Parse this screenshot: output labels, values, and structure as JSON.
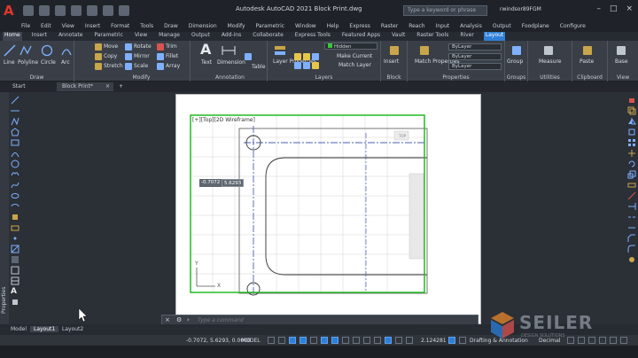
{
  "titlebar": {
    "title": "Autodesk AutoCAD 2021   Block Print.dwg",
    "search_placeholder": "Type a keyword or phrase",
    "user": "rwindsor89FGM"
  },
  "menubar": {
    "items": [
      "File",
      "Edit",
      "View",
      "Insert",
      "Format",
      "Tools",
      "Draw",
      "Dimension",
      "Modify",
      "Parametric",
      "Window",
      "Help",
      "Express",
      "Raster",
      "Reach",
      "Input",
      "Analysis",
      "Output",
      "Foodplane",
      "Configure"
    ]
  },
  "ribbon_tabs": [
    "Home",
    "Insert",
    "Annotate",
    "Parametric",
    "View",
    "Manage",
    "Output",
    "Add-ins",
    "Collaborate",
    "Express Tools",
    "Featured Apps",
    "Vault",
    "Raster Tools",
    "River",
    "Layout"
  ],
  "ribbon": {
    "draw": {
      "title": "Draw",
      "line": "Line",
      "polyline": "Polyline",
      "circle": "Circle",
      "arc": "Arc"
    },
    "modify": {
      "title": "Modify",
      "move": "Move",
      "rotate": "Rotate",
      "trim": "Trim",
      "copy": "Copy",
      "mirror": "Mirror",
      "fillet": "Fillet",
      "stretch": "Stretch",
      "scale": "Scale",
      "array": "Array"
    },
    "annotation": {
      "title": "Annotation",
      "text": "Text",
      "dimension": "Dimension",
      "table": "Table"
    },
    "layers": {
      "title": "Layers",
      "layer_properties": "Layer Properties",
      "layer_name": "Hidden",
      "make_current": "Make Current",
      "match_layer": "Match Layer"
    },
    "block": {
      "title": "Block",
      "insert": "Insert"
    },
    "properties": {
      "title": "Properties",
      "match": "Match Properties",
      "bylayer1": "ByLayer",
      "bylayer2": "ByLayer",
      "bylayer3": "ByLayer"
    },
    "groups": {
      "title": "Groups",
      "group": "Group"
    },
    "utilities": {
      "title": "Utilities",
      "measure": "Measure"
    },
    "clipboard": {
      "title": "Clipboard",
      "paste": "Paste"
    },
    "view": {
      "title": "View",
      "base": "Base"
    }
  },
  "file_tabs": {
    "start": "Start",
    "block_print": "Block Print*",
    "close": "×",
    "add": "+"
  },
  "side": {
    "properties": "Properties"
  },
  "viewport": {
    "label": "[+][Top][2D Wireframe]",
    "coord_x": "-0.7072",
    "coord_y": "5.6293",
    "top_btn": "TOP",
    "ucs_y": "Y",
    "ucs_x": "X"
  },
  "command": {
    "placeholder": "Type a command"
  },
  "layout_tabs": {
    "model": "Model",
    "layout1": "Layout1",
    "layout2": "Layout2"
  },
  "status": {
    "coords": "-0.7072, 5.6293, 0.0000",
    "model": "MODEL",
    "scale": "2.124281",
    "workspace": "Drafting & Annotation",
    "units": "Decimal"
  },
  "watermark": {
    "name": "SEILER",
    "sub": "DESIGN SOLUTIONS"
  },
  "colors": {
    "accent": "#2e7fd8",
    "viewport_border": "#22bb22",
    "logo": "#e0362b"
  }
}
